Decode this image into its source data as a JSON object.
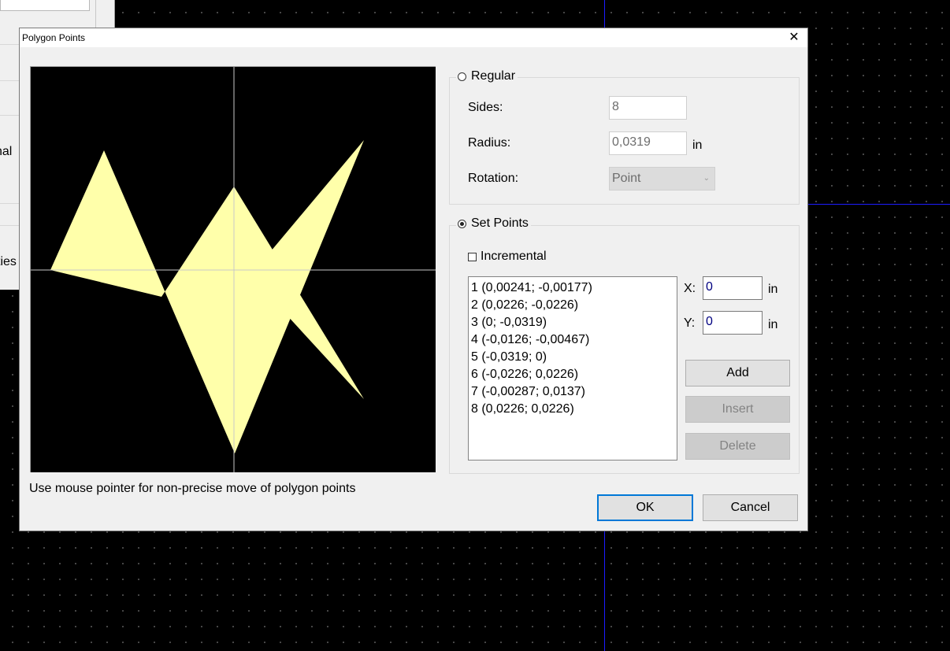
{
  "background": {
    "panel_texts": [
      "nal",
      "ties"
    ]
  },
  "dialog": {
    "title": "Polygon Points",
    "close_glyph": "✕"
  },
  "preview": {
    "fill_color": "#ffffaa",
    "crosshair_color": "#c8c8c8"
  },
  "regular": {
    "label": "Regular",
    "selected": false,
    "sides_label": "Sides:",
    "sides_value": "8",
    "radius_label": "Radius:",
    "radius_value": "0,0319",
    "radius_unit": "in",
    "rotation_label": "Rotation:",
    "rotation_value": "Point"
  },
  "set_points": {
    "label": "Set Points",
    "selected": true,
    "incremental_label": "Incremental",
    "incremental_checked": false,
    "points": [
      "1 (0,00241; -0,00177)",
      "2 (0,0226; -0,0226)",
      "3 (0; -0,0319)",
      "4 (-0,0126; -0,00467)",
      "5 (-0,0319; 0)",
      "6 (-0,0226; 0,0226)",
      "7 (-0,00287; 0,0137)",
      "8 (0,0226; 0,0226)"
    ],
    "x_label": "X:",
    "x_value": "0",
    "x_unit": "in",
    "y_label": "Y:",
    "y_value": "0",
    "y_unit": "in",
    "add_label": "Add",
    "insert_label": "Insert",
    "delete_label": "Delete"
  },
  "hint": "Use mouse pointer for non-precise move of polygon points",
  "buttons": {
    "ok": "OK",
    "cancel": "Cancel"
  }
}
